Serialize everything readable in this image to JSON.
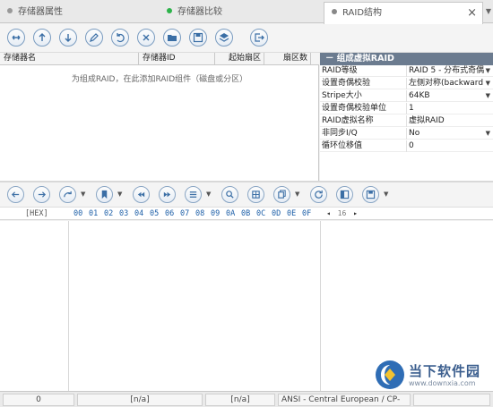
{
  "tabs": [
    {
      "label": "存储器属性",
      "dot": "#999999",
      "active": false
    },
    {
      "label": "存储器比较",
      "dot": "#2db34a",
      "active": false
    },
    {
      "label": "RAID结构",
      "dot": "#888888",
      "active": true
    }
  ],
  "tab_close": "×",
  "tab_scroll": "▼",
  "table": {
    "columns": [
      "存储器名",
      "存储器ID",
      "起始扇区",
      "扇区数"
    ],
    "hint": "为组成RAID，在此添加RAID组件（磁盘或分区）"
  },
  "props": {
    "header": "－  组成虚拟RAID",
    "rows": [
      {
        "key": "RAID等级",
        "value": "RAID 5 - 分布式奇偶",
        "dropdown": true
      },
      {
        "key": "设置奇偶校验",
        "value": "左侧对称(backward",
        "dropdown": true
      },
      {
        "key": "Stripe大小",
        "value": "64KB",
        "dropdown": true
      },
      {
        "key": "设置奇偶校验单位",
        "value": "1",
        "dropdown": false
      },
      {
        "key": "RAID虚拟名称",
        "value": "虚拟RAID",
        "dropdown": false
      },
      {
        "key": "非同步I/Q",
        "value": "No",
        "dropdown": true
      },
      {
        "key": "循环位移值",
        "value": "0",
        "dropdown": false
      }
    ]
  },
  "hex": {
    "label": "[HEX]",
    "columns": [
      "00",
      "01",
      "02",
      "03",
      "04",
      "05",
      "06",
      "07",
      "08",
      "09",
      "0A",
      "0B",
      "0C",
      "0D",
      "0E",
      "0F"
    ],
    "nav_prev": "◂",
    "nav_value": "16",
    "nav_next": "▸"
  },
  "status": {
    "offset": "0",
    "value1": "[n/a]",
    "value2": "[n/a]",
    "encoding": "ANSI - Central European / CP-"
  },
  "watermark": {
    "title": "当下软件园",
    "url": "www.downxia.com"
  },
  "colors": {
    "accent": "#1d5fa8",
    "props_header": "#6b7b8f",
    "icon": "#3a6ea5"
  }
}
